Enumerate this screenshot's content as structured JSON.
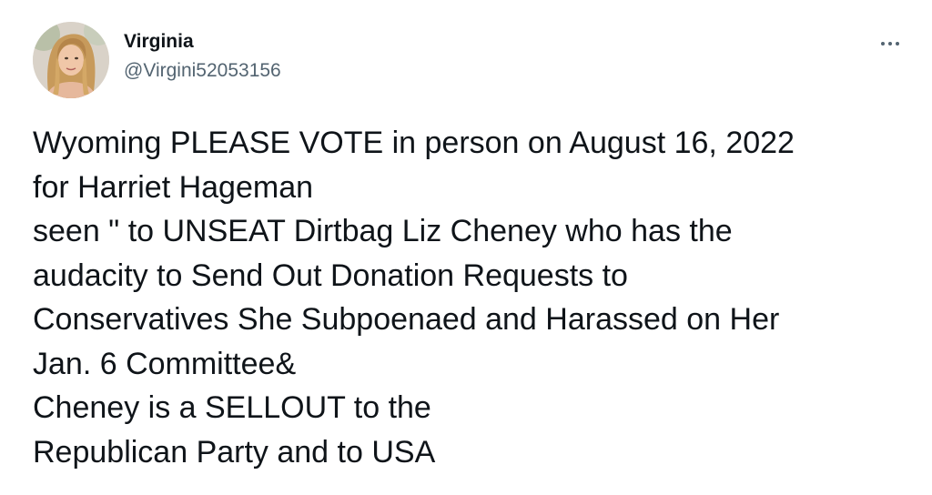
{
  "author": {
    "display_name": "Virginia",
    "handle": "@Virgini52053156",
    "avatar_icon": "profile-photo-icon"
  },
  "menu": {
    "icon": "more-options-icon"
  },
  "tweet": {
    "lines": [
      "Wyoming PLEASE VOTE in person on August 16, 2022",
      "for Harriet Hageman",
      "seen \" to UNSEAT Dirtbag Liz Cheney who has the",
      "audacity to Send Out Donation Requests to",
      "Conservatives She Subpoenaed and Harassed on Her",
      "Jan. 6 Committee&",
      "Cheney is a SELLOUT to the",
      "Republican Party and to USA"
    ]
  },
  "colors": {
    "text": "#0f1419",
    "secondary": "#536471",
    "background": "#ffffff"
  }
}
